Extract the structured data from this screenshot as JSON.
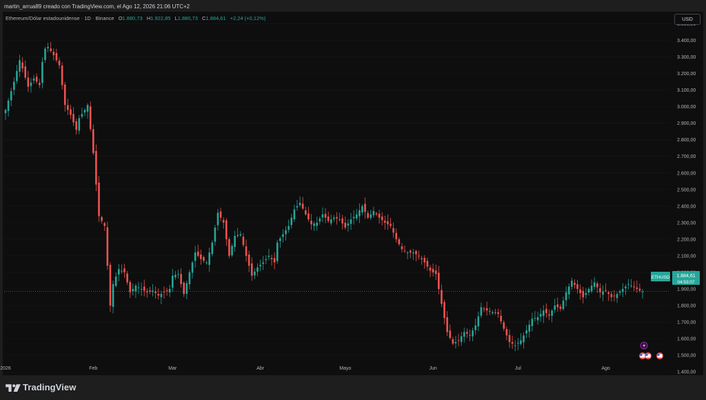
{
  "caption": "martin_arrua89 creado con TradingView.com, el Ago 12, 2026 21:06 UTC+2",
  "legend": {
    "symbol": "Ethereum/Dólar estadounidense · 1D · Binance",
    "o_label": "O",
    "o_value": "1.880,73",
    "h_label": "H",
    "h_value": "1.922,85",
    "l_label": "L",
    "l_value": "1.880,73",
    "c_label": "C",
    "c_value": "1.884,61",
    "change": "+2,24 (+0,12%)"
  },
  "currency_button": "USD",
  "price_tag": {
    "symbol": "ETHUSD",
    "price": "1.884,61",
    "countdown": "04:53:07"
  },
  "brand": "TradingView",
  "icons": [
    "lightning-icon",
    "us-flag-icon"
  ],
  "colors": {
    "up": "#26a69a",
    "down": "#ef5350",
    "background": "#0e0e0e",
    "tag": "#26a69a",
    "event": "#9c27b0"
  },
  "chart_data": {
    "type": "candlestick",
    "ylim": [
      1380,
      3560
    ],
    "yticks": [
      1400,
      1500,
      1600,
      1700,
      1800,
      1900,
      2000,
      2100,
      2200,
      2300,
      2400,
      2500,
      2600,
      2700,
      2800,
      2900,
      3000,
      3100,
      3200,
      3300,
      3400,
      3500
    ],
    "ytick_labels": [
      "1.400,00",
      "1.500,00",
      "1.600,00",
      "1.700,00",
      "1.800,00",
      "1.900,00",
      "2.000,00",
      "2.100,00",
      "2.200,00",
      "2.300,00",
      "2.400,00",
      "2.500,00",
      "2.600,00",
      "2.700,00",
      "2.800,00",
      "2.900,00",
      "3.000,00",
      "3.100,00",
      "3.200,00",
      "3.300,00",
      "3.400,00",
      "3.500,00"
    ],
    "xticks": [
      {
        "label": "2026",
        "day": 0
      },
      {
        "label": "Feb",
        "day": 31
      },
      {
        "label": "Mar",
        "day": 59
      },
      {
        "label": "Abr",
        "day": 90
      },
      {
        "label": "Mayo",
        "day": 120
      },
      {
        "label": "Jun",
        "day": 151
      },
      {
        "label": "Jul",
        "day": 181
      },
      {
        "label": "Ago",
        "day": 212
      }
    ],
    "last_price": 1884.61,
    "close_path": [
      [
        0,
        2980
      ],
      [
        3,
        3150
      ],
      [
        5,
        3280
      ],
      [
        6,
        3230
      ],
      [
        8,
        3120
      ],
      [
        10,
        3170
      ],
      [
        12,
        3130
      ],
      [
        13,
        3270
      ],
      [
        14,
        3350
      ],
      [
        15,
        3360
      ],
      [
        17,
        3310
      ],
      [
        19,
        3250
      ],
      [
        21,
        3010
      ],
      [
        23,
        2950
      ],
      [
        25,
        2860
      ],
      [
        26,
        2930
      ],
      [
        28,
        2980
      ],
      [
        29,
        3010
      ],
      [
        31,
        2720
      ],
      [
        33,
        2340
      ],
      [
        35,
        2280
      ],
      [
        37,
        1800
      ],
      [
        38,
        1930
      ],
      [
        40,
        2020
      ],
      [
        42,
        2000
      ],
      [
        44,
        1880
      ],
      [
        46,
        1920
      ],
      [
        48,
        1900
      ],
      [
        50,
        1880
      ],
      [
        52,
        1890
      ],
      [
        54,
        1860
      ],
      [
        56,
        1880
      ],
      [
        58,
        1900
      ],
      [
        59,
        1980
      ],
      [
        61,
        1990
      ],
      [
        63,
        1870
      ],
      [
        65,
        2000
      ],
      [
        67,
        2120
      ],
      [
        69,
        2080
      ],
      [
        71,
        2060
      ],
      [
        73,
        2180
      ],
      [
        75,
        2360
      ],
      [
        77,
        2300
      ],
      [
        79,
        2100
      ],
      [
        81,
        2220
      ],
      [
        83,
        2230
      ],
      [
        85,
        2100
      ],
      [
        87,
        1980
      ],
      [
        89,
        2030
      ],
      [
        91,
        2060
      ],
      [
        93,
        2100
      ],
      [
        95,
        2060
      ],
      [
        96,
        2180
      ],
      [
        98,
        2230
      ],
      [
        100,
        2280
      ],
      [
        102,
        2380
      ],
      [
        104,
        2420
      ],
      [
        106,
        2350
      ],
      [
        108,
        2290
      ],
      [
        110,
        2300
      ],
      [
        112,
        2350
      ],
      [
        114,
        2310
      ],
      [
        116,
        2330
      ],
      [
        118,
        2320
      ],
      [
        120,
        2270
      ],
      [
        122,
        2320
      ],
      [
        124,
        2350
      ],
      [
        126,
        2400
      ],
      [
        128,
        2330
      ],
      [
        130,
        2370
      ],
      [
        132,
        2330
      ],
      [
        134,
        2300
      ],
      [
        136,
        2280
      ],
      [
        138,
        2200
      ],
      [
        140,
        2140
      ],
      [
        142,
        2120
      ],
      [
        144,
        2120
      ],
      [
        146,
        2100
      ],
      [
        148,
        2060
      ],
      [
        150,
        2010
      ],
      [
        152,
        1990
      ],
      [
        154,
        1810
      ],
      [
        156,
        1640
      ],
      [
        158,
        1570
      ],
      [
        160,
        1590
      ],
      [
        162,
        1640
      ],
      [
        164,
        1620
      ],
      [
        166,
        1680
      ],
      [
        168,
        1790
      ],
      [
        170,
        1770
      ],
      [
        172,
        1760
      ],
      [
        174,
        1750
      ],
      [
        176,
        1660
      ],
      [
        178,
        1580
      ],
      [
        180,
        1560
      ],
      [
        182,
        1590
      ],
      [
        184,
        1650
      ],
      [
        186,
        1720
      ],
      [
        188,
        1730
      ],
      [
        190,
        1770
      ],
      [
        192,
        1740
      ],
      [
        194,
        1800
      ],
      [
        196,
        1780
      ],
      [
        198,
        1880
      ],
      [
        200,
        1950
      ],
      [
        202,
        1900
      ],
      [
        204,
        1850
      ],
      [
        206,
        1900
      ],
      [
        208,
        1940
      ],
      [
        210,
        1880
      ],
      [
        212,
        1890
      ],
      [
        214,
        1850
      ],
      [
        216,
        1870
      ],
      [
        218,
        1900
      ],
      [
        220,
        1930
      ],
      [
        222,
        1910
      ],
      [
        224,
        1890
      ],
      [
        225,
        1885
      ]
    ]
  }
}
